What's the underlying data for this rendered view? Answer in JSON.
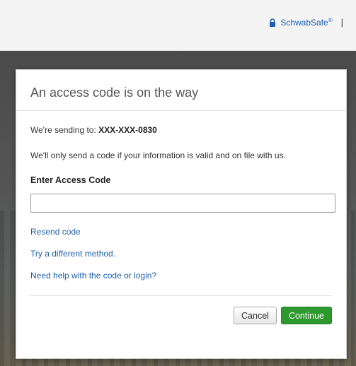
{
  "header": {
    "schwabsafe_label": "SchwabSafe",
    "registered_mark": "®",
    "separator": "|"
  },
  "modal": {
    "title": "An access code is on the way",
    "sending_prefix": "We're sending to: ",
    "phone_masked": "XXX-XXX-0830",
    "note": "We'll only send a code if your information is valid and on file with us.",
    "code_label": "Enter Access Code",
    "code_value": "",
    "resend_link": "Resend code",
    "different_method_link": "Try a different method.",
    "help_link": "Need help with the code or login?",
    "cancel_label": "Cancel",
    "continue_label": "Continue"
  },
  "colors": {
    "link": "#1e5fb3",
    "continue_button": "#2e9a2e"
  },
  "icons": {
    "schwabsafe": "lock-icon"
  }
}
